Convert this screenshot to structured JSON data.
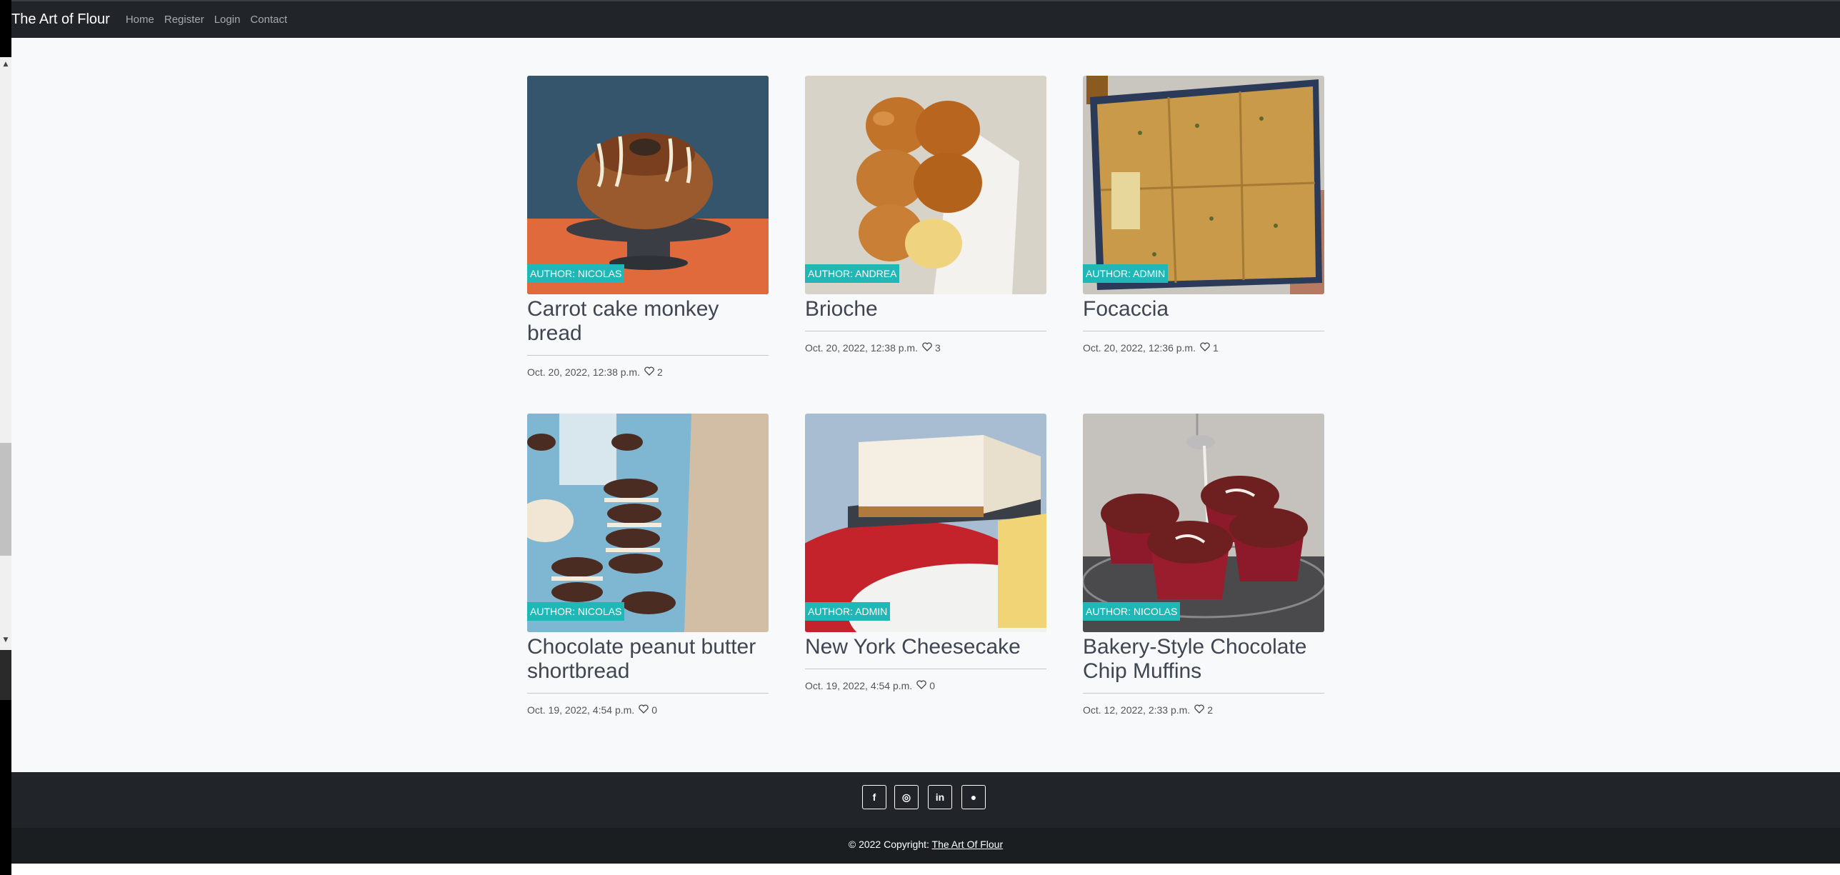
{
  "nav": {
    "brand": "The Art of Flour",
    "links": [
      "Home",
      "Register",
      "Login",
      "Contact"
    ]
  },
  "posts": [
    {
      "title": "Carrot cake monkey bread",
      "author": "AUTHOR: NICOLAS",
      "date": "Oct. 20, 2022, 12:38 p.m.",
      "likes": "2",
      "image": "carrot-cake-monkey-bread"
    },
    {
      "title": "Brioche",
      "author": "AUTHOR: ANDREA",
      "date": "Oct. 20, 2022, 12:38 p.m.",
      "likes": "3",
      "image": "brioche"
    },
    {
      "title": "Focaccia",
      "author": "AUTHOR: ADMIN",
      "date": "Oct. 20, 2022, 12:36 p.m.",
      "likes": "1",
      "image": "focaccia"
    },
    {
      "title": "Chocolate peanut butter shortbread",
      "author": "AUTHOR: NICOLAS",
      "date": "Oct. 19, 2022, 4:54 p.m.",
      "likes": "0",
      "image": "chocolate-shortbread"
    },
    {
      "title": "New York Cheesecake",
      "author": "AUTHOR: ADMIN",
      "date": "Oct. 19, 2022, 4:54 p.m.",
      "likes": "0",
      "image": "cheesecake"
    },
    {
      "title": "Bakery-Style Chocolate Chip Muffins",
      "author": "AUTHOR: NICOLAS",
      "date": "Oct. 12, 2022, 2:33 p.m.",
      "likes": "2",
      "image": "muffins"
    }
  ],
  "footer": {
    "social": [
      {
        "icon": "facebook-icon",
        "glyph": "f"
      },
      {
        "icon": "instagram-icon",
        "glyph": "◎"
      },
      {
        "icon": "linkedin-icon",
        "glyph": "in"
      },
      {
        "icon": "github-icon",
        "glyph": "●"
      }
    ],
    "copyright_prefix": "© 2022 Copyright:",
    "copyright_link": "The Art Of Flour"
  },
  "colors": {
    "navbar": "#212529",
    "badge": "#20b7b7",
    "page_bg": "#f8f9fa"
  }
}
